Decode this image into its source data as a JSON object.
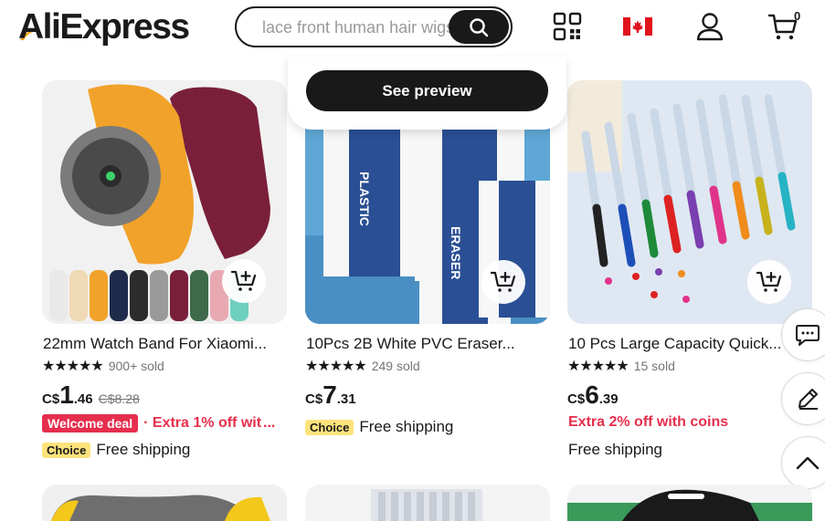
{
  "header": {
    "logo_text": "AliExpress",
    "search_placeholder": "lace front human hair wigs",
    "cart_count": "0",
    "icons": [
      "qr-code-icon",
      "canada-flag-icon",
      "account-icon",
      "cart-icon",
      "search-icon"
    ]
  },
  "preview": {
    "label": "See preview"
  },
  "products": [
    {
      "title": "22mm Watch Band For Xiaomi...",
      "rating": "★★★★★",
      "sold": "900+ sold",
      "currency": "C$",
      "price_int": "1",
      "price_dec": ".46",
      "old_price": "C$8.28",
      "badge": "Welcome deal",
      "promo": "· Extra 1% off wit",
      "promo_more": "...",
      "choice": "Choice",
      "shipping": "Free shipping"
    },
    {
      "title": "10Pcs 2B White PVC Eraser...",
      "rating": "★★★★★",
      "sold": "249 sold",
      "currency": "C$",
      "price_int": "7",
      "price_dec": ".31",
      "choice": "Choice",
      "shipping": "Free shipping"
    },
    {
      "title": "10 Pcs Large Capacity Quick...",
      "rating": "★★★★★",
      "sold": "15 sold",
      "currency": "C$",
      "price_int": "6",
      "price_dec": ".39",
      "promo": "Extra 2% off with coins",
      "shipping": "Free shipping"
    }
  ],
  "floating": [
    "chat-icon",
    "edit-icon",
    "chevron-up-icon"
  ],
  "colors": {
    "accent_red": "#e62e4d",
    "choice_yellow": "#fde37c",
    "dark": "#191919"
  }
}
